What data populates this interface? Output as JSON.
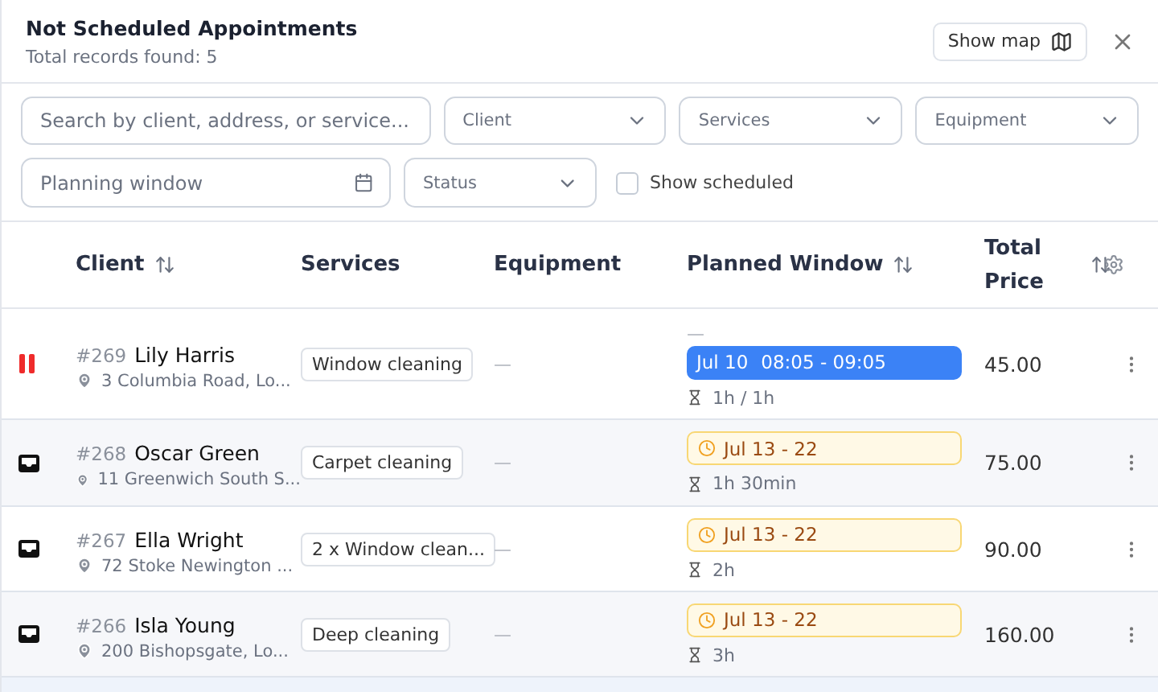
{
  "header": {
    "title": "Not Scheduled Appointments",
    "subtitle": "Total records found: 5",
    "map_button": "Show map"
  },
  "filters": {
    "search": {
      "placeholder": "Search by client, address, or service..."
    },
    "selects": [
      {
        "placeholder": "Client"
      },
      {
        "placeholder": "Services"
      },
      {
        "placeholder": "Equipment"
      }
    ],
    "planning": {
      "placeholder": "Planning window"
    },
    "status": {
      "placeholder": "Status"
    },
    "show_scheduled": {
      "label": "Show scheduled",
      "checked": false
    }
  },
  "table": {
    "columns": [
      {
        "label": "Client",
        "sortable": true
      },
      {
        "label": "Services",
        "sortable": false
      },
      {
        "label": "Equipment",
        "sortable": false
      },
      {
        "label": "Planned Window",
        "sortable": true
      },
      {
        "label": "Total Price",
        "sortable": true
      }
    ],
    "rows": [
      {
        "kind": "paused",
        "number": "#269",
        "name": "Lily Harris",
        "address": "3 Columbia Road, Lo...",
        "service": "Window cleaning",
        "equipment": "—",
        "window": {
          "kind": "scheduled",
          "above": "—",
          "date": "Jul 10",
          "time": "08:05 - 09:05"
        },
        "duration": "1h / 1h",
        "price": "45.00"
      },
      {
        "kind": "inbox",
        "number": "#268",
        "name": "Oscar Green",
        "address": "11 Greenwich South S...",
        "service": "Carpet cleaning",
        "equipment": "—",
        "window": {
          "kind": "range",
          "date": "Jul 13 - 22"
        },
        "duration": "1h 30min",
        "price": "75.00"
      },
      {
        "kind": "inbox",
        "number": "#267",
        "name": "Ella Wright",
        "address": "72 Stoke Newington ...",
        "service": "2 x Window clean...",
        "equipment": "—",
        "window": {
          "kind": "range",
          "date": "Jul 13 - 22"
        },
        "duration": "2h",
        "price": "90.00"
      },
      {
        "kind": "inbox",
        "number": "#266",
        "name": "Isla Young",
        "address": "200 Bishopsgate, Lo...",
        "service": "Deep cleaning",
        "equipment": "—",
        "window": {
          "kind": "range",
          "date": "Jul 13 - 22"
        },
        "duration": "3h",
        "price": "160.00"
      }
    ]
  }
}
